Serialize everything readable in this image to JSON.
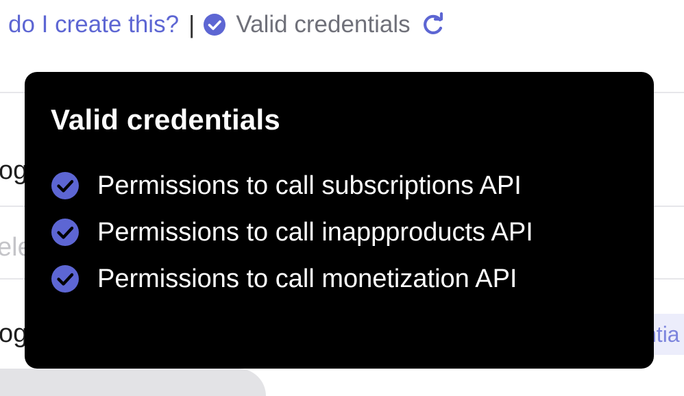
{
  "header": {
    "help_link_text": "do I create this?",
    "separator": "|",
    "status_text": "Valid credentials",
    "status_icon": "check-circle-icon",
    "refresh_icon": "refresh-icon"
  },
  "background": {
    "row1_fragment": "og",
    "row2_fragment": "ele",
    "row3_fragment": "og",
    "chip_text": "ntia"
  },
  "tooltip": {
    "title": "Valid credentials",
    "permissions": [
      {
        "label": "Permissions to call subscriptions API",
        "icon": "check-circle-icon"
      },
      {
        "label": "Permissions to call inappproducts API",
        "icon": "check-circle-icon"
      },
      {
        "label": "Permissions to call monetization API",
        "icon": "check-circle-icon"
      }
    ]
  },
  "colors": {
    "accent": "#5d66d3",
    "tooltip_bg": "#000000",
    "tooltip_text": "#ffffff",
    "status_text": "#6f7079"
  }
}
